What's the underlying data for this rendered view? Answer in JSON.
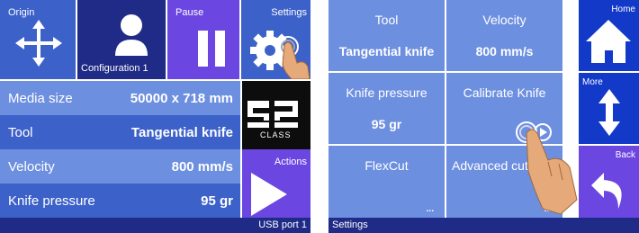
{
  "screen1": {
    "origin_label": "Origin",
    "configuration_label": "Configuration 1",
    "pause_label": "Pause",
    "settings_label": "Settings",
    "rows": [
      {
        "key": "Media size",
        "value": "50000 x 718 mm"
      },
      {
        "key": "Tool",
        "value": "Tangential knife"
      },
      {
        "key": "Velocity",
        "value": "800 mm/s"
      },
      {
        "key": "Knife pressure",
        "value": "95 gr"
      }
    ],
    "actions_label": "Actions",
    "logo_text": "CLASS",
    "status_right": "USB port 1"
  },
  "screen2": {
    "tiles": [
      {
        "title": "Tool",
        "value": "Tangential knife"
      },
      {
        "title": "Velocity",
        "value": "800 mm/s"
      },
      {
        "title": "Knife pressure",
        "value": "95 gr"
      },
      {
        "title": "Calibrate Knife",
        "value": ""
      },
      {
        "title": "FlexCut",
        "value": ""
      },
      {
        "title": "Advanced cutting",
        "value": ""
      }
    ],
    "more_indicator": "...",
    "home_label": "Home",
    "more_label": "More",
    "back_label": "Back",
    "status_left": "Settings"
  },
  "colors": {
    "tile_dark": "#1f2b86",
    "tile_blue": "#3c61c9",
    "tile_light": "#6d8fe0",
    "purple": "#6b46e0",
    "nav_blue": "#1239c8"
  },
  "icons": {
    "origin": "four-way-arrow-icon",
    "configuration": "user-icon",
    "pause": "pause-icon",
    "settings": "gear-icon",
    "actions": "play-icon",
    "home": "home-icon",
    "more": "up-down-arrow-icon",
    "back": "back-arrow-icon",
    "touch": "touch-hand-icon"
  }
}
